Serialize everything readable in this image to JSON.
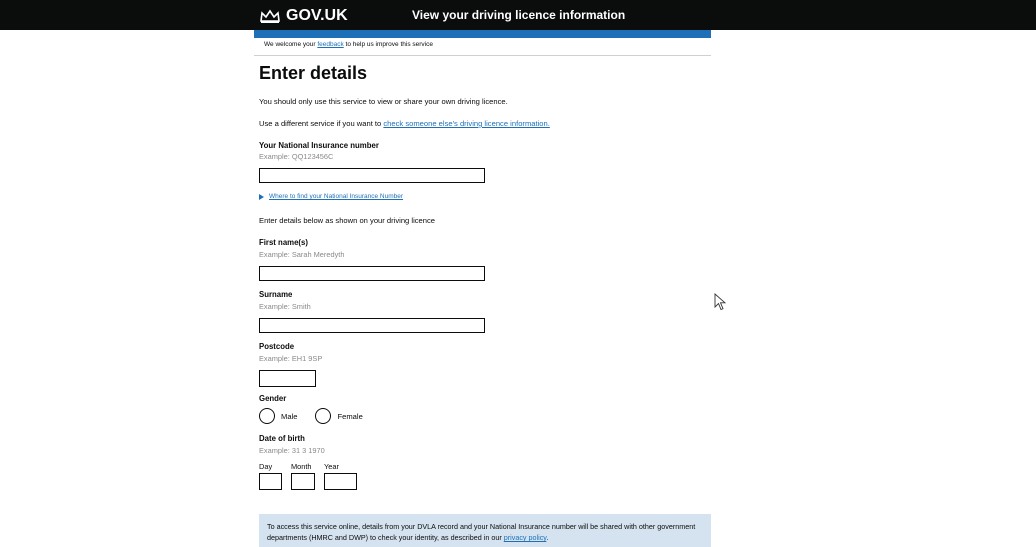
{
  "header": {
    "logo_text": "GOV.UK",
    "service_name": "View your driving licence information"
  },
  "beta_banner": {
    "prefix": "We welcome your ",
    "link": "feedback",
    "suffix": " to help us improve this service"
  },
  "page": {
    "title": "Enter details",
    "intro": "You should only use this service to view or share your own driving licence.",
    "alt_service_prefix": "Use a different service if you want to ",
    "alt_service_link": "check someone else's driving licence information.",
    "details_intro": "Enter details below as shown on your driving licence"
  },
  "fields": {
    "ni": {
      "label": "Your National Insurance number",
      "hint": "Example: QQ123456C",
      "value": ""
    },
    "ni_help_link": "Where to find your National Insurance Number",
    "first_name": {
      "label": "First name(s)",
      "hint": "Example: Sarah Meredyth",
      "value": ""
    },
    "surname": {
      "label": "Surname",
      "hint": "Example: Smith",
      "value": ""
    },
    "postcode": {
      "label": "Postcode",
      "hint": "Example: EH1 9SP",
      "value": ""
    },
    "gender": {
      "label": "Gender",
      "options": [
        "Male",
        "Female"
      ]
    },
    "dob": {
      "label": "Date of birth",
      "hint": "Example: 31 3 1970",
      "day_label": "Day",
      "month_label": "Month",
      "year_label": "Year"
    }
  },
  "notice": {
    "text": "To access this service online, details from your DVLA record and your National Insurance number will be shared with other government departments (HMRC and DWP) to check your identity, as described in our ",
    "link": "privacy policy",
    "suffix": "."
  },
  "colors": {
    "header_bg": "#0b0c0c",
    "accent_blue": "#1d70b8",
    "notice_bg": "#d5e3f0",
    "hint_grey": "#8a8a8a"
  }
}
